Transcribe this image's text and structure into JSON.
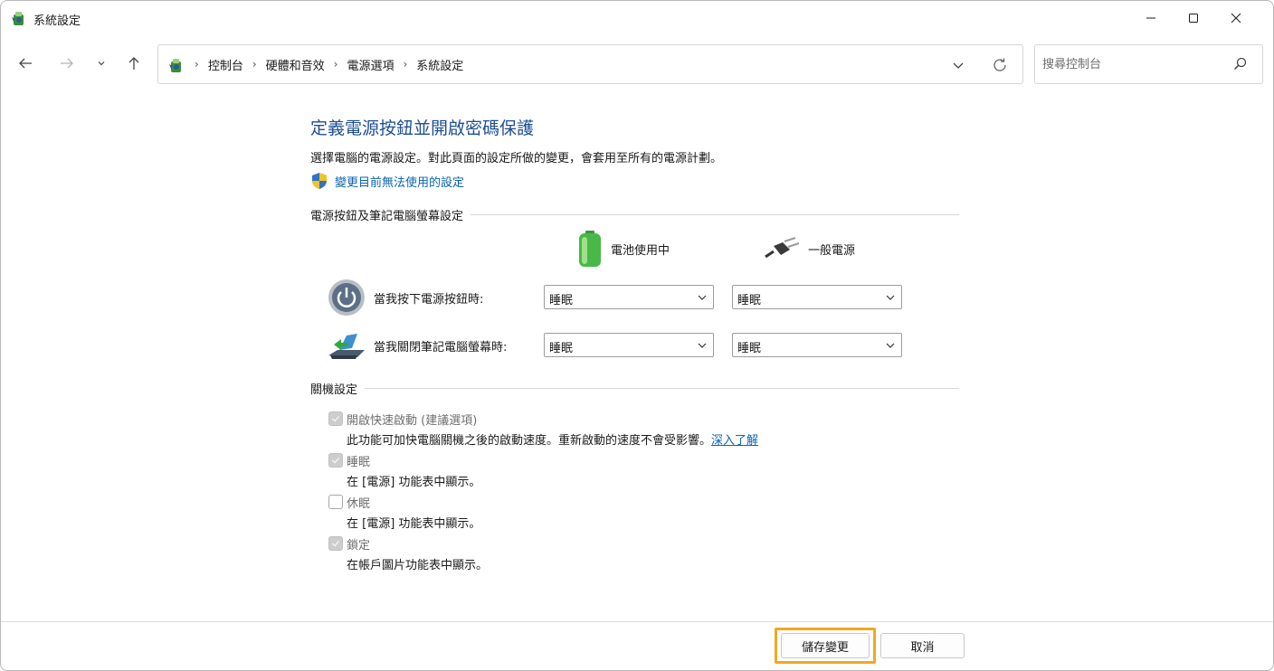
{
  "window": {
    "title": "系統設定"
  },
  "navigation": {
    "breadcrumbs": [
      "控制台",
      "硬體和音效",
      "電源選項",
      "系統設定"
    ],
    "search_placeholder": "搜尋控制台"
  },
  "page": {
    "title": "定義電源按鈕並開啟密碼保護",
    "description": "選擇電腦的電源設定。對此頁面的設定所做的變更，會套用至所有的電源計劃。",
    "change_link": "變更目前無法使用的設定"
  },
  "power_section": {
    "heading": "電源按鈕及筆記電腦螢幕設定",
    "columns": {
      "battery": "電池使用中",
      "ac": "一般電源"
    },
    "rows": [
      {
        "label": "當我按下電源按鈕時:",
        "battery_value": "睡眠",
        "ac_value": "睡眠"
      },
      {
        "label": "當我關閉筆記電腦螢幕時:",
        "battery_value": "睡眠",
        "ac_value": "睡眠"
      }
    ]
  },
  "shutdown_section": {
    "heading": "關機設定",
    "options": [
      {
        "label": "開啟快速啟動 (建議選項)",
        "checked": true,
        "enabled": false,
        "description": "此功能可加快電腦關機之後的啟動速度。重新啟動的速度不會受影響。",
        "link": "深入了解"
      },
      {
        "label": "睡眠",
        "checked": true,
        "enabled": false,
        "description": "在 [電源] 功能表中顯示。"
      },
      {
        "label": "休眠",
        "checked": false,
        "enabled": false,
        "description": "在 [電源] 功能表中顯示。"
      },
      {
        "label": "鎖定",
        "checked": true,
        "enabled": false,
        "description": "在帳戶圖片功能表中顯示。"
      }
    ]
  },
  "footer": {
    "save_label": "儲存變更",
    "cancel_label": "取消"
  },
  "colors": {
    "title_blue": "#1e4f94",
    "link_blue": "#0b63b0",
    "highlight": "#f0a91d"
  }
}
